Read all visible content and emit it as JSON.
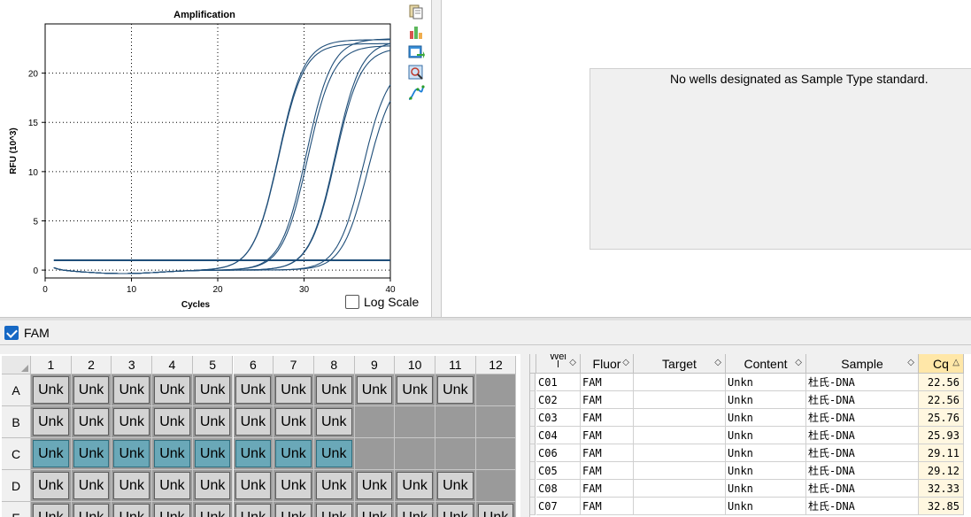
{
  "chart_data": {
    "type": "line",
    "title": "Amplification",
    "xlabel": "Cycles",
    "ylabel": "RFU (10^3)",
    "xlim": [
      0,
      40
    ],
    "ylim": [
      -0.8,
      25
    ],
    "xticks": [
      0,
      10,
      20,
      30,
      40
    ],
    "yticks": [
      0,
      5,
      10,
      15,
      20
    ],
    "grid": true,
    "line_color": "#1f4e79",
    "series": [
      {
        "well": "C01",
        "cq": 22.56,
        "plateau": 23.4
      },
      {
        "well": "C02",
        "cq": 22.56,
        "plateau": 23.0
      },
      {
        "well": "C03",
        "cq": 25.76,
        "plateau": 23.5
      },
      {
        "well": "C04",
        "cq": 25.93,
        "plateau": 22.8
      },
      {
        "well": "C06",
        "cq": 29.11,
        "plateau": 23.3
      },
      {
        "well": "C05",
        "cq": 29.12,
        "plateau": 22.6
      },
      {
        "well": "C08",
        "cq": 32.33,
        "plateau": 21.0
      },
      {
        "well": "C07",
        "cq": 32.85,
        "plateau": 20.0
      }
    ],
    "baseline_value": 1.0
  },
  "chart_labels": {
    "title": "Amplification",
    "xlabel": "Cycles",
    "ylabel": "RFU (10^3)",
    "xticks": [
      "0",
      "10",
      "20",
      "30",
      "40"
    ],
    "yticks": [
      "0",
      "5",
      "10",
      "15",
      "20"
    ]
  },
  "toolbar": {
    "icons": [
      "copy-icon",
      "bar-chart-icon",
      "export-icon",
      "zoom-chart-icon",
      "curve-icon"
    ]
  },
  "log_scale": {
    "label": "Log Scale",
    "checked": false
  },
  "standard_panel": {
    "message": "No wells designated as Sample Type standard."
  },
  "fluor_filter": {
    "label": "FAM",
    "checked": true
  },
  "plate": {
    "columns": [
      "1",
      "2",
      "3",
      "4",
      "5",
      "6",
      "7",
      "8",
      "9",
      "10",
      "11",
      "12"
    ],
    "rows": [
      "A",
      "B",
      "C",
      "D",
      "E"
    ],
    "well_label": "Unk",
    "filled_counts": [
      11,
      8,
      8,
      11,
      12
    ],
    "selected_row": "C"
  },
  "results_table": {
    "headers": [
      "Wel l",
      "Fluor",
      "Target",
      "Content",
      "Sample",
      "Cq"
    ],
    "sorted_column": "Cq",
    "rows": [
      [
        "C01",
        "FAM",
        "",
        "Unkn",
        "杜氏-DNA",
        "22.56"
      ],
      [
        "C02",
        "FAM",
        "",
        "Unkn",
        "杜氏-DNA",
        "22.56"
      ],
      [
        "C03",
        "FAM",
        "",
        "Unkn",
        "杜氏-DNA",
        "25.76"
      ],
      [
        "C04",
        "FAM",
        "",
        "Unkn",
        "杜氏-DNA",
        "25.93"
      ],
      [
        "C06",
        "FAM",
        "",
        "Unkn",
        "杜氏-DNA",
        "29.11"
      ],
      [
        "C05",
        "FAM",
        "",
        "Unkn",
        "杜氏-DNA",
        "29.12"
      ],
      [
        "C08",
        "FAM",
        "",
        "Unkn",
        "杜氏-DNA",
        "32.33"
      ],
      [
        "C07",
        "FAM",
        "",
        "Unkn",
        "杜氏-DNA",
        "32.85"
      ]
    ]
  }
}
